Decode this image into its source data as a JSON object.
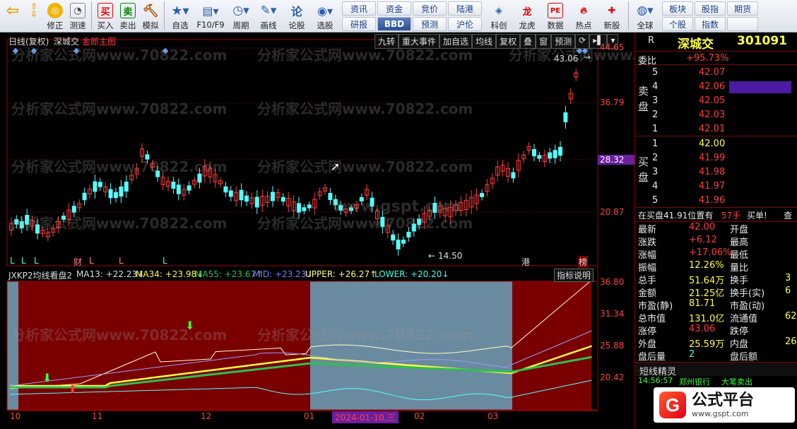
{
  "toolbar": {
    "buttons": [
      {
        "name": "back",
        "label": "",
        "icon": "back-arrow-icon"
      },
      {
        "name": "fix",
        "label": "修正",
        "icon": "circle-icon"
      },
      {
        "name": "test",
        "label": "测速",
        "icon": "speed-icon"
      },
      {
        "name": "buy",
        "label": "买入",
        "icon": "buy-icon",
        "glyph": "买"
      },
      {
        "name": "sell",
        "label": "卖出",
        "icon": "sell-icon",
        "glyph": "卖"
      },
      {
        "name": "sim",
        "label": "模拟",
        "icon": "hammer-icon"
      },
      {
        "name": "fav",
        "label": "自选",
        "icon": "star-icon"
      },
      {
        "name": "f10",
        "label": "F10/F9",
        "icon": "f10-icon"
      },
      {
        "name": "period",
        "label": "周期",
        "icon": "clock-icon"
      },
      {
        "name": "draw",
        "label": "画线",
        "icon": "pen-icon"
      },
      {
        "name": "lungu",
        "label": "论股",
        "icon": "discuss-icon"
      },
      {
        "name": "pick",
        "label": "选股",
        "icon": "select-icon"
      }
    ],
    "grid1": [
      "资讯",
      "资金",
      "竞价",
      "陆港",
      "研报",
      "BBD",
      "预测",
      "沪伦"
    ],
    "grid1b": [
      "科创",
      "龙虎",
      "数据",
      "热点",
      "新股"
    ],
    "globe": "全球",
    "grid2": [
      "板块",
      "股指",
      "期货",
      "个股",
      "指数",
      ""
    ]
  },
  "chart": {
    "title_left": "日线(复权)",
    "stock_short": "深城交",
    "main_indicator": "金郎主图",
    "tabs": [
      "九转",
      "重大事件",
      "加自选",
      "均线",
      "复权",
      "叠",
      "窗",
      "预测"
    ],
    "price_axis": [
      "44.65",
      "36.79",
      "28.32",
      "20.87"
    ],
    "highlight_price": "28.32",
    "hi_label": "43.06",
    "lo_label": "14.50",
    "markers_bottom": [
      "L",
      "L",
      "L",
      "财",
      "L",
      "L",
      "L",
      "港",
      "榜"
    ],
    "indicator_line": {
      "name": "JXKP2均线看盘2",
      "ma13": "MA13: +22.23↓",
      "ma34": "MA34: +23.98↓",
      "ma55": "MA55: +23.67↑",
      "mid": "MID: +23.23↓",
      "upper": "UPPER: +26.27↑",
      "lower": "LOWER: +20.20↓"
    },
    "indicator_help": "指标说明",
    "ind_axis": [
      "36.80",
      "31.34",
      "25.88",
      "20.42"
    ],
    "x_labels": [
      "10",
      "11",
      "12",
      "01",
      "02",
      "03"
    ],
    "cursor_date": "2024-01-10,三",
    "watermark": "分析家公式网www.70822.com",
    "center_wm": "www.gspt.com"
  },
  "quote": {
    "name": "深城交",
    "code": "301091",
    "r": "R",
    "weibi_label": "委比",
    "weibi": "+95.73%",
    "sell_label": "卖盘",
    "buy_label": "买盘",
    "asks": [
      {
        "n": "5",
        "p": "42.07",
        "v": ""
      },
      {
        "n": "4",
        "p": "42.06",
        "v": ""
      },
      {
        "n": "3",
        "p": "42.05",
        "v": ""
      },
      {
        "n": "2",
        "p": "42.03",
        "v": ""
      },
      {
        "n": "1",
        "p": "42.01",
        "v": ""
      }
    ],
    "bids": [
      {
        "n": "1",
        "p": "42.00",
        "v": ""
      },
      {
        "n": "2",
        "p": "41.99",
        "v": ""
      },
      {
        "n": "3",
        "p": "41.98",
        "v": ""
      },
      {
        "n": "4",
        "p": "41.97",
        "v": ""
      },
      {
        "n": "5",
        "p": "41.96",
        "v": ""
      }
    ],
    "buy_note": "在买盘41.91位置有",
    "buy_note_vol": "57手",
    "buy_note_tail": "买单!",
    "stats": [
      {
        "k": "最新",
        "v": "42.00",
        "k2": "开盘",
        "v2": ""
      },
      {
        "k": "涨跌",
        "v": "+6.12",
        "k2": "最高",
        "v2": ""
      },
      {
        "k": "涨幅",
        "v": "+17.06%",
        "k2": "最低",
        "v2": ""
      },
      {
        "k": "振幅",
        "v": "12.26%",
        "k2": "量比",
        "v2": ""
      },
      {
        "k": "总手",
        "v": "51.64万",
        "k2": "换手",
        "v2": "3"
      },
      {
        "k": "金额",
        "v": "21.25亿",
        "k2": "换手(实)",
        "v2": "6"
      },
      {
        "k": "市盈(静)",
        "v": "81.71",
        "k2": "市盈(动)",
        "v2": ""
      },
      {
        "k": "总市值",
        "v": "131.0亿",
        "k2": "流通值",
        "v2": "62"
      },
      {
        "k": "涨停",
        "v": "43.06",
        "k2": "跌停",
        "v2": ""
      },
      {
        "k": "外盘",
        "v": "25.59万",
        "k2": "内盘",
        "v2": "26"
      },
      {
        "k": "盘后量",
        "v": "2",
        "k2": "盘后额",
        "v2": ""
      }
    ],
    "sprite_title": "短线精灵",
    "sprite_row": {
      "time": "14:56:57",
      "stock": "郑州银行",
      "event": "大笔卖出"
    },
    "logo_text": "公式平台",
    "logo_url": "www.gspt.com"
  },
  "colors": {
    "up": "#ff3c3c",
    "down": "#54ffff",
    "bg": "#000000",
    "axis": "#b00000"
  }
}
